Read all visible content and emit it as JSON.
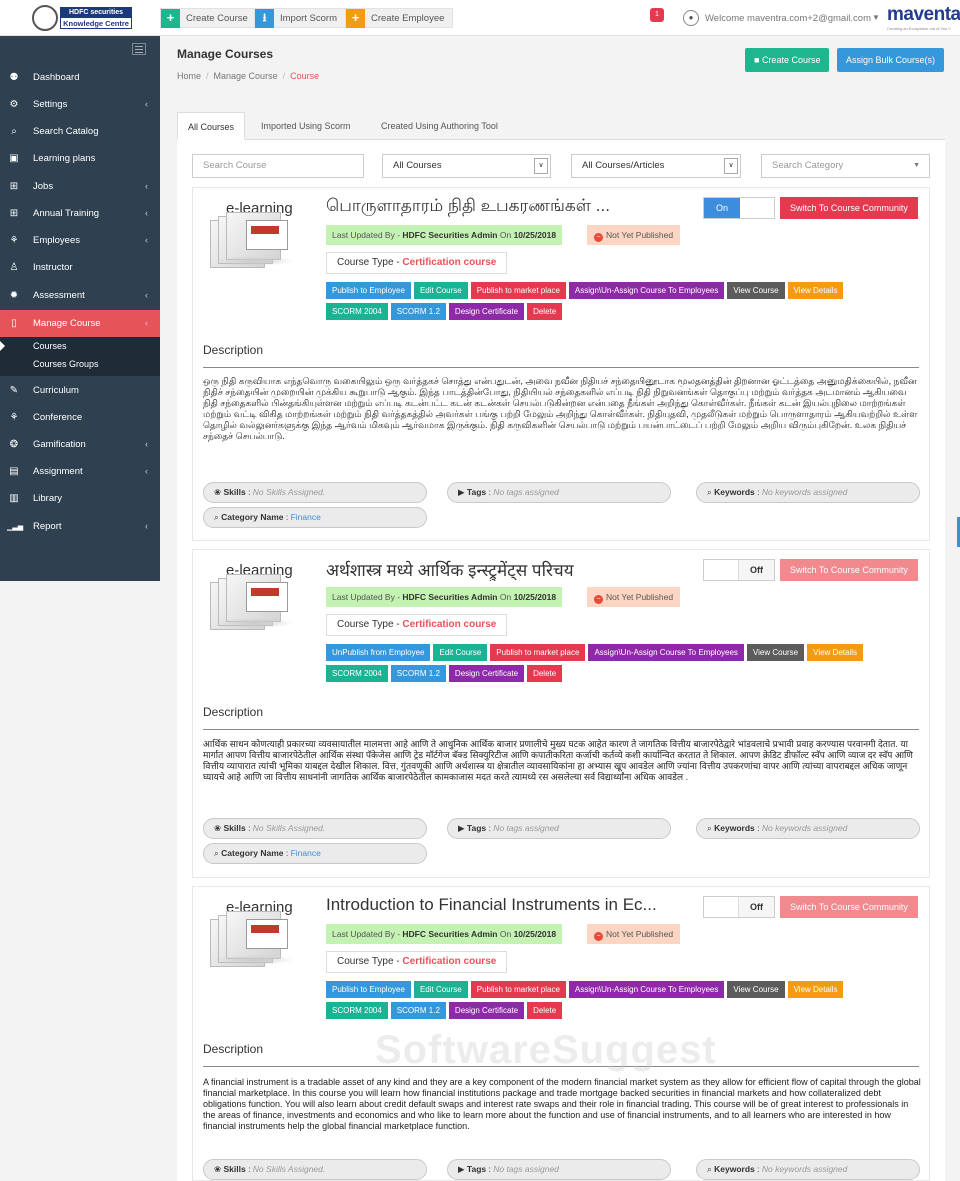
{
  "header": {
    "logo_line1": "HDFC securities",
    "logo_line2": "Knowledge Centre",
    "create_course": "Create Course",
    "import_scorm": "Import Scorm",
    "create_employee": "Create Employee",
    "notification_count": "1",
    "welcome": "Welcome maventra.com+2@gmail.com",
    "brand": "maventa",
    "brand_tag": "Creating an Ecosystem out of You !!",
    "colors": {
      "green": "#1fb58f",
      "blue": "#3498db",
      "orange": "#f39c12"
    }
  },
  "sidebar": {
    "items": [
      {
        "label": "Dashboard",
        "icon": "dashboard-icon",
        "glyph": "⚉",
        "caret": false
      },
      {
        "label": "Settings",
        "icon": "settings-icon",
        "glyph": "⚙",
        "caret": true
      },
      {
        "label": "Search Catalog",
        "icon": "search-icon",
        "glyph": "⌕",
        "caret": false
      },
      {
        "label": "Learning plans",
        "icon": "learning-plans-icon",
        "glyph": "▣",
        "caret": false
      },
      {
        "label": "Jobs",
        "icon": "jobs-icon",
        "glyph": "⊞",
        "caret": true
      },
      {
        "label": "Annual Training",
        "icon": "annual-training-icon",
        "glyph": "⊞",
        "caret": true
      },
      {
        "label": "Employees",
        "icon": "employees-icon",
        "glyph": "⚘",
        "caret": true
      },
      {
        "label": "Instructor",
        "icon": "instructor-icon",
        "glyph": "♙",
        "caret": false
      },
      {
        "label": "Assessment",
        "icon": "assessment-icon",
        "glyph": "✹",
        "caret": true
      },
      {
        "label": "Manage Course",
        "icon": "manage-course-icon",
        "glyph": "▯",
        "caret": true
      },
      {
        "label": "Curriculum",
        "icon": "curriculum-icon",
        "glyph": "✎",
        "caret": false
      },
      {
        "label": "Conference",
        "icon": "conference-icon",
        "glyph": "⚘",
        "caret": false
      },
      {
        "label": "Gamification",
        "icon": "gamification-icon",
        "glyph": "❂",
        "caret": true
      },
      {
        "label": "Assignment",
        "icon": "assignment-icon",
        "glyph": "▤",
        "caret": true
      },
      {
        "label": "Library",
        "icon": "library-icon",
        "glyph": "▥",
        "caret": false
      },
      {
        "label": "Report",
        "icon": "report-icon",
        "glyph": "▁▃▅",
        "caret": true
      }
    ],
    "sub_items": [
      "Courses",
      "Courses Groups"
    ],
    "active_color": "#e6545a"
  },
  "main": {
    "title": "Manage Courses",
    "breadcrumb": [
      "Home",
      "Manage Course",
      "Course"
    ],
    "create_course": "Create Course",
    "assign_bulk": "Assign Bulk Course(s)",
    "tabs": [
      "All Courses",
      "Imported Using Scorm",
      "Created Using Authoring Tool"
    ],
    "filters": {
      "search_placeholder": "Search Course",
      "course_select": "All Courses",
      "type_select": "All Courses/Articles",
      "category_placeholder": "Search Category"
    }
  },
  "common": {
    "thumb_title": "e-learning",
    "updated_prefix": "Last Updated By - ",
    "updated_by": "HDFC Securities Admin",
    "updated_on_prefix": " On ",
    "updated_on": "10/25/2018",
    "status": "Not Yet Published",
    "course_type_label": "Course Type - ",
    "course_type": "Certification course",
    "description_heading": "Description",
    "switch_community": "Switch To Course Community",
    "skills_label": "Skills",
    "skills_value": "No Skills Assigned.",
    "tags_label": "Tags",
    "tags_value": "No tags assigned",
    "keywords_label": "Keywords",
    "keywords_value": "No keywords assigned",
    "category_label": "Category Name",
    "category_value": "Finance",
    "btn_edit": "Edit Course",
    "btn_market": "Publish to market place",
    "btn_assign": "Assign\\Un-Assign Course To Employees",
    "btn_view": "View Course",
    "btn_details": "View Details",
    "btn_scorm2004": "SCORM 2004",
    "btn_scorm12": "SCORM 1.2",
    "btn_cert": "Design Certificate",
    "btn_delete": "Delete"
  },
  "courses": [
    {
      "title": "பொருளாதாரம் நிதி உபகரணங்கள் ...",
      "toggle": "On",
      "publish_btn": "Publish to Employee",
      "description": "ஒரு நிதி கருவியாக எந்தவொரு வகையிலும் ஒரு வர்த்தகச் சொத்து என்பதுடன், அவை நவீன நிதியச் சந்தையினூடாக மூலதனத்தின் திறனான ஓட்டத்தை அனுமதிக்கையில், நவீன நிதிச் சந்தையின் முறையின் முக்கிய கூறுபாடு ஆகும். இந்த பாடத்தின்போது, நிதியியல் சந்தைகளில் எப்படி நிதி நிறுவனங்கள் தொகுப்பு மற்றும் வர்த்தக அடமானம் ஆகியவை நிதி சந்தைகளில் பின்தங்கியுள்ளன மற்றும் எப்படி கடன்பட்ட கடன் கடன்கள் செயல்படுகின்றன என்பதை நீங்கள் அறிந்து கொள்வீர்கள். நீங்கள் கடன் இயல்புநிலை மாற்றங்கள் மற்றும் வட்டி விகித மாற்றங்கள் மற்றும் நிதி வர்த்தகத்தில் அவர்கள் பங்கு பற்றி மேலும் அறிந்து கொள்வீர்கள். நிதியுதவி, முதலீடுகள் மற்றும் பொருளாதாரம் ஆகியவற்றில் உள்ள தொழில் வல்லுனர்களுக்கு இந்த ஆர்வம் மிகவும் ஆர்வமாக இருக்கும். நிதி கருவிகளின் செயல்பாடு மற்றும் பயன்பாட்டைப் பற்றி மேலும் அறிய விரும்புகிறேன். உலக நிதியச் சந்தைச் செயல்பாடு."
    },
    {
      "title": "अर्थशास्त्र मध्ये आर्थिक इन्स्ट्रुमेंट्स परिचय",
      "toggle": "Off",
      "publish_btn": "UnPublish from Employee",
      "description": "आर्थिक साधन कोणत्याही प्रकारच्या व्यवसायातील मालमत्ता आहे आणि ते आधुनिक आर्थिक बाजार प्रणालीचे मुख्य घटक आहेत कारण ते जागतिक वित्तीय बाजारपेठेद्वारे भांडवलाचे प्रभावी प्रवाह करण्यास परवानगी देतात. या मार्गात आपण वित्तीय बाजारपेठेतील आर्थिक संस्था पॅकेजेस आणि ट्रेड मॉर्टगेज बॅक्ड सिक्युरिटीज आणि कपातीकरिता कर्जाची कर्तव्ये कशी कार्यान्वित करतात ते शिकाल. आपण क्रेडिट डीफॉल्ट स्वॅप आणि व्याज दर स्वॅप आणि वित्तीय व्यापारात त्यांची भूमिका याबद्दल देखील शिकाल. वित्त, गुंतवणूकी आणि अर्थशास्त्र या क्षेत्रातील व्यावसायिकांना हा अभ्यास खूप आवडेल आणि ज्यांना वित्तीय उपकरणांचा वापर आणि त्यांच्या वापराबद्दल अधिक जाणून घ्यायचे आहे आणि जा वित्तीय साधनांनी जागतिक आर्थिक बाजारपेठेतील कामकाजास मदत करते त्यामध्ये रस असलेल्या सर्व विद्यार्थ्यांना अधिक आवडेल ."
    },
    {
      "title": "Introduction to Financial Instruments in Ec...",
      "toggle": "Off",
      "publish_btn": "Publish to Employee",
      "description": "A financial instrument is a tradable asset of any kind and they are a key component of the modern financial market system as they allow for efficient flow of capital through the global financial marketplace. In this course you will learn how financial institutions package and trade mortgage backed securities in financial markets and how collateralized debt obligations function. You will also learn about credit default swaps and interest rate swaps and their role in financial trading. This course will be of great interest to professionals in the areas of finance, investments and economics and who like to learn more about the function and use of financial instruments, and to all learners who are interested in how financial instruments help the global financial marketplace function."
    }
  ],
  "watermark": "SoftwareSuggest"
}
